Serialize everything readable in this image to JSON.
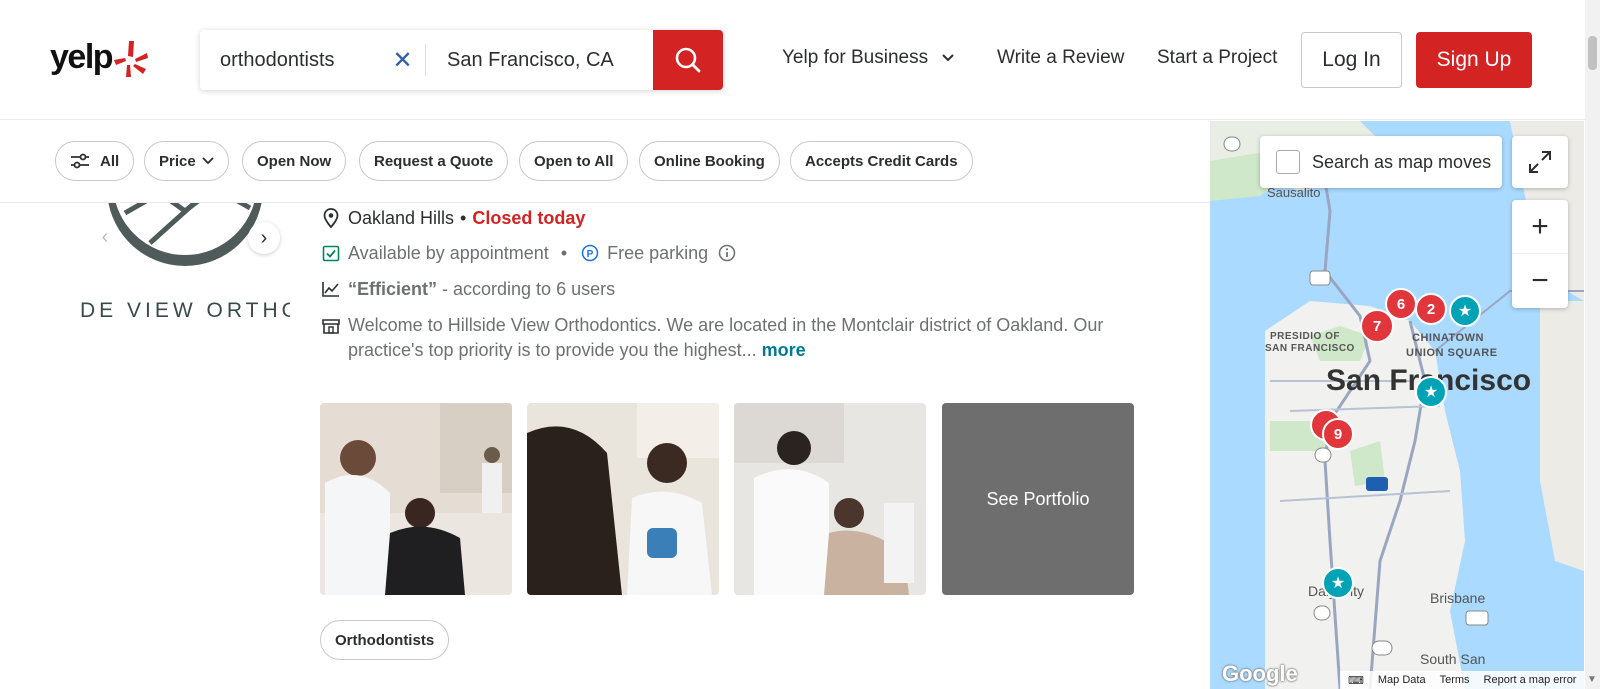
{
  "header": {
    "logo": "yelp",
    "search": {
      "term": "orthodontists",
      "location": "San Francisco, CA"
    },
    "nav": {
      "business": "Yelp for Business",
      "review": "Write a Review",
      "project": "Start a Project"
    },
    "login": "Log In",
    "signup": "Sign Up"
  },
  "filters": [
    "All",
    "Price",
    "Open Now",
    "Request a Quote",
    "Open to All",
    "Online Booking",
    "Accepts Credit Cards"
  ],
  "business": {
    "logo_text": "DE VIEW ORTHODO",
    "neighborhood": "Oakland Hills",
    "status": "Closed today",
    "appointment": "Available by appointment",
    "parking": "Free parking",
    "highlight_quote": "“Efficient”",
    "highlight_rest": " - according to 6 users",
    "description": "Welcome to Hillside View Orthodontics. We are located in the Montclair district of Oakland. Our practice's top priority is to provide you the highest...",
    "more": "more",
    "see_portfolio": "See Portfolio",
    "tag": "Orthodontists"
  },
  "map": {
    "search_as_moves": "Search as map moves",
    "labels": {
      "sausalito": "Sausalito",
      "presidio": "PRESIDIO OF",
      "presidio2": "SAN FRANCISCO",
      "chinatown": "CHINATOWN",
      "union": "UNION SQUARE",
      "sf": "San Francisco",
      "daly": "Daly City",
      "brisbane": "Brisbane",
      "ssf": "South San"
    },
    "markers": [
      "6",
      "2",
      "7",
      "9"
    ],
    "footer": {
      "map_data": "Map Data",
      "terms": "Terms",
      "report": "Report a map error"
    },
    "google": "Google"
  },
  "colors": {
    "brand": "#d32323",
    "link": "#027a97",
    "teal": "#00a3b6"
  }
}
